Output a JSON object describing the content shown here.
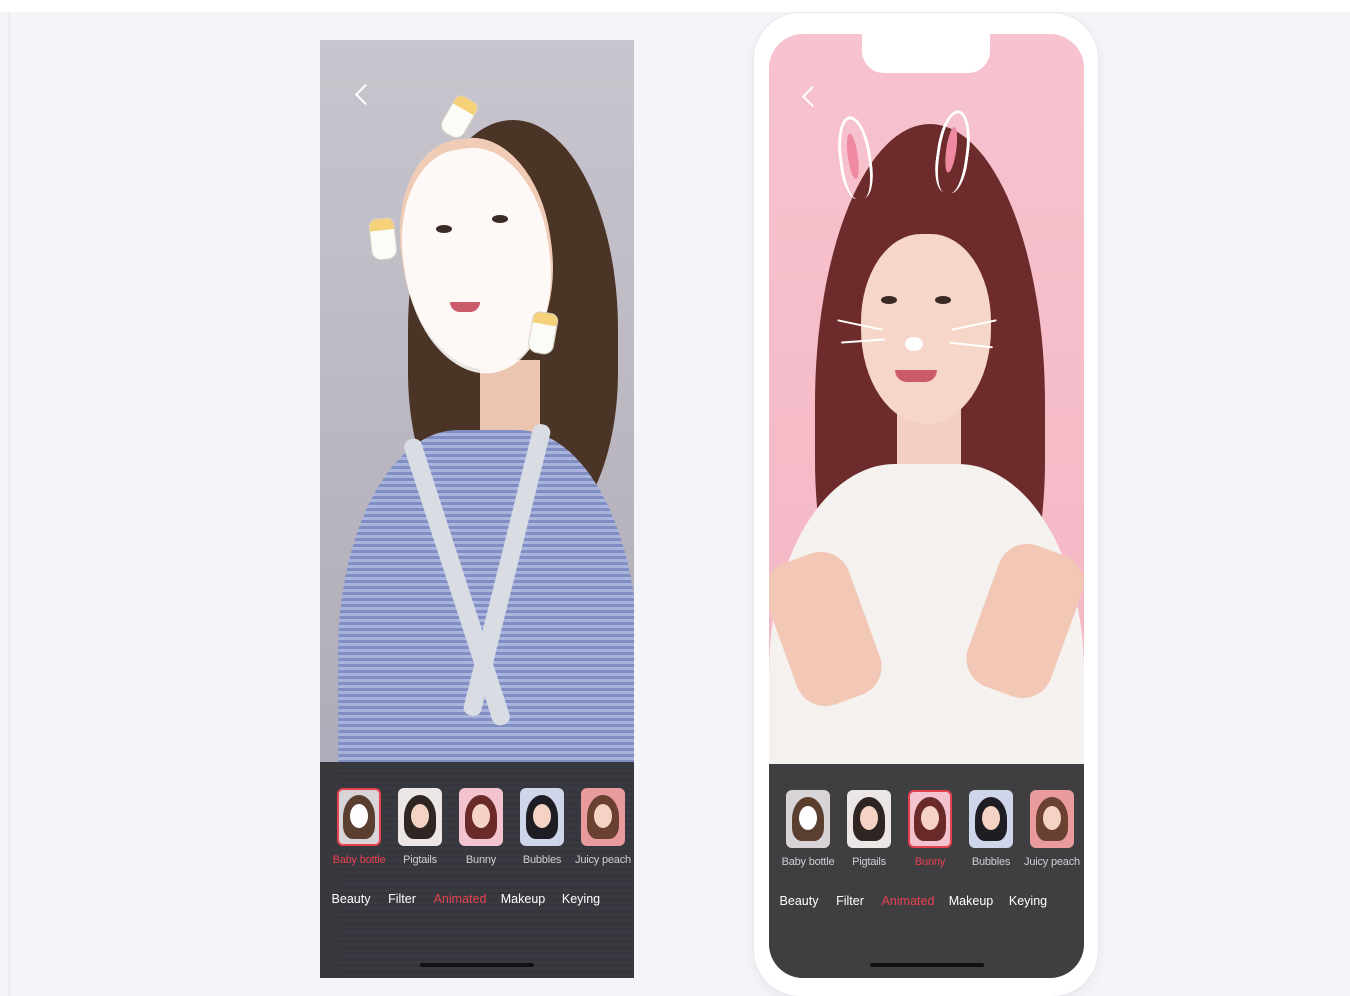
{
  "colors": {
    "accent": "#e6414f",
    "panel": "#303034",
    "tab_text": "#ffffff",
    "label_text": "#cfcfd3"
  },
  "icons": {
    "back": "chevron-left-icon"
  },
  "phones": [
    {
      "id": "left",
      "active_effect": "Baby bottle",
      "active_tab": "Animated",
      "effects": [
        {
          "label": "Baby bottle",
          "selected": true
        },
        {
          "label": "Pigtails",
          "selected": false
        },
        {
          "label": "Bunny",
          "selected": false
        },
        {
          "label": "Bubbles",
          "selected": false
        },
        {
          "label": "Juicy peach",
          "selected": false
        }
      ],
      "tabs": [
        "Beauty",
        "Filter",
        "Animated",
        "Makeup",
        "Keying"
      ]
    },
    {
      "id": "right",
      "active_effect": "Bunny",
      "active_tab": "Animated",
      "effects": [
        {
          "label": "Baby bottle",
          "selected": false
        },
        {
          "label": "Pigtails",
          "selected": false
        },
        {
          "label": "Bunny",
          "selected": true
        },
        {
          "label": "Bubbles",
          "selected": false
        },
        {
          "label": "Juicy peach",
          "selected": false
        }
      ],
      "tabs": [
        "Beauty",
        "Filter",
        "Animated",
        "Makeup",
        "Keying"
      ]
    }
  ]
}
